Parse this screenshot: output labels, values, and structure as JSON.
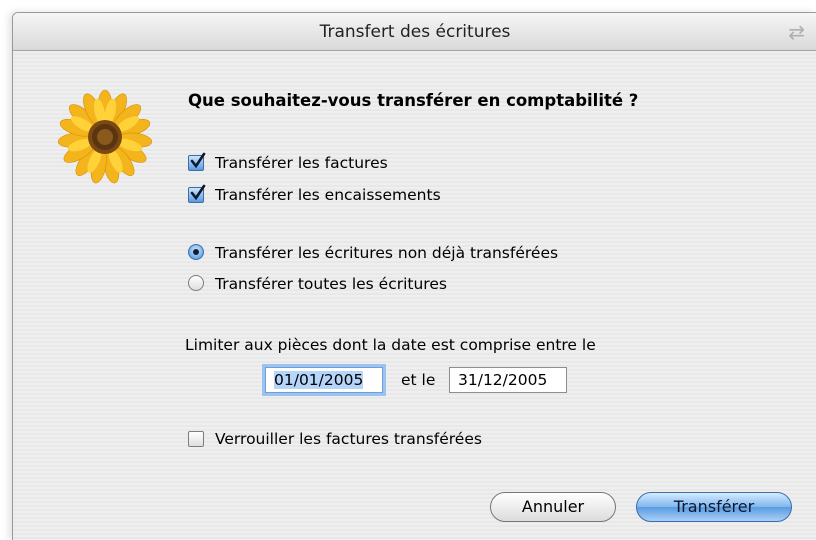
{
  "window": {
    "title": "Transfert des écritures",
    "toolbar_icon": "swap-arrows-icon"
  },
  "dialog": {
    "icon": "sunflower-icon",
    "heading": "Que souhaitez-vous transférer en comptabilité ?",
    "checkboxes": [
      {
        "label": "Transférer les factures",
        "checked": true
      },
      {
        "label": "Transférer les encaissements",
        "checked": true
      }
    ],
    "radios": [
      {
        "label": "Transférer les écritures non déjà transférées",
        "selected": true
      },
      {
        "label": "Transférer toutes les écritures",
        "selected": false
      }
    ],
    "date_range": {
      "label": "Limiter aux pièces dont la date est comprise entre le",
      "from": "01/01/2005",
      "separator": "et le",
      "to": "31/12/2005"
    },
    "lock_checkbox": {
      "label": "Verrouiller les factures transférées",
      "checked": false
    },
    "buttons": {
      "cancel": "Annuler",
      "confirm": "Transférer"
    }
  },
  "colors": {
    "accent": "#5a9be0",
    "focus_ring": "#9bc3ef"
  }
}
